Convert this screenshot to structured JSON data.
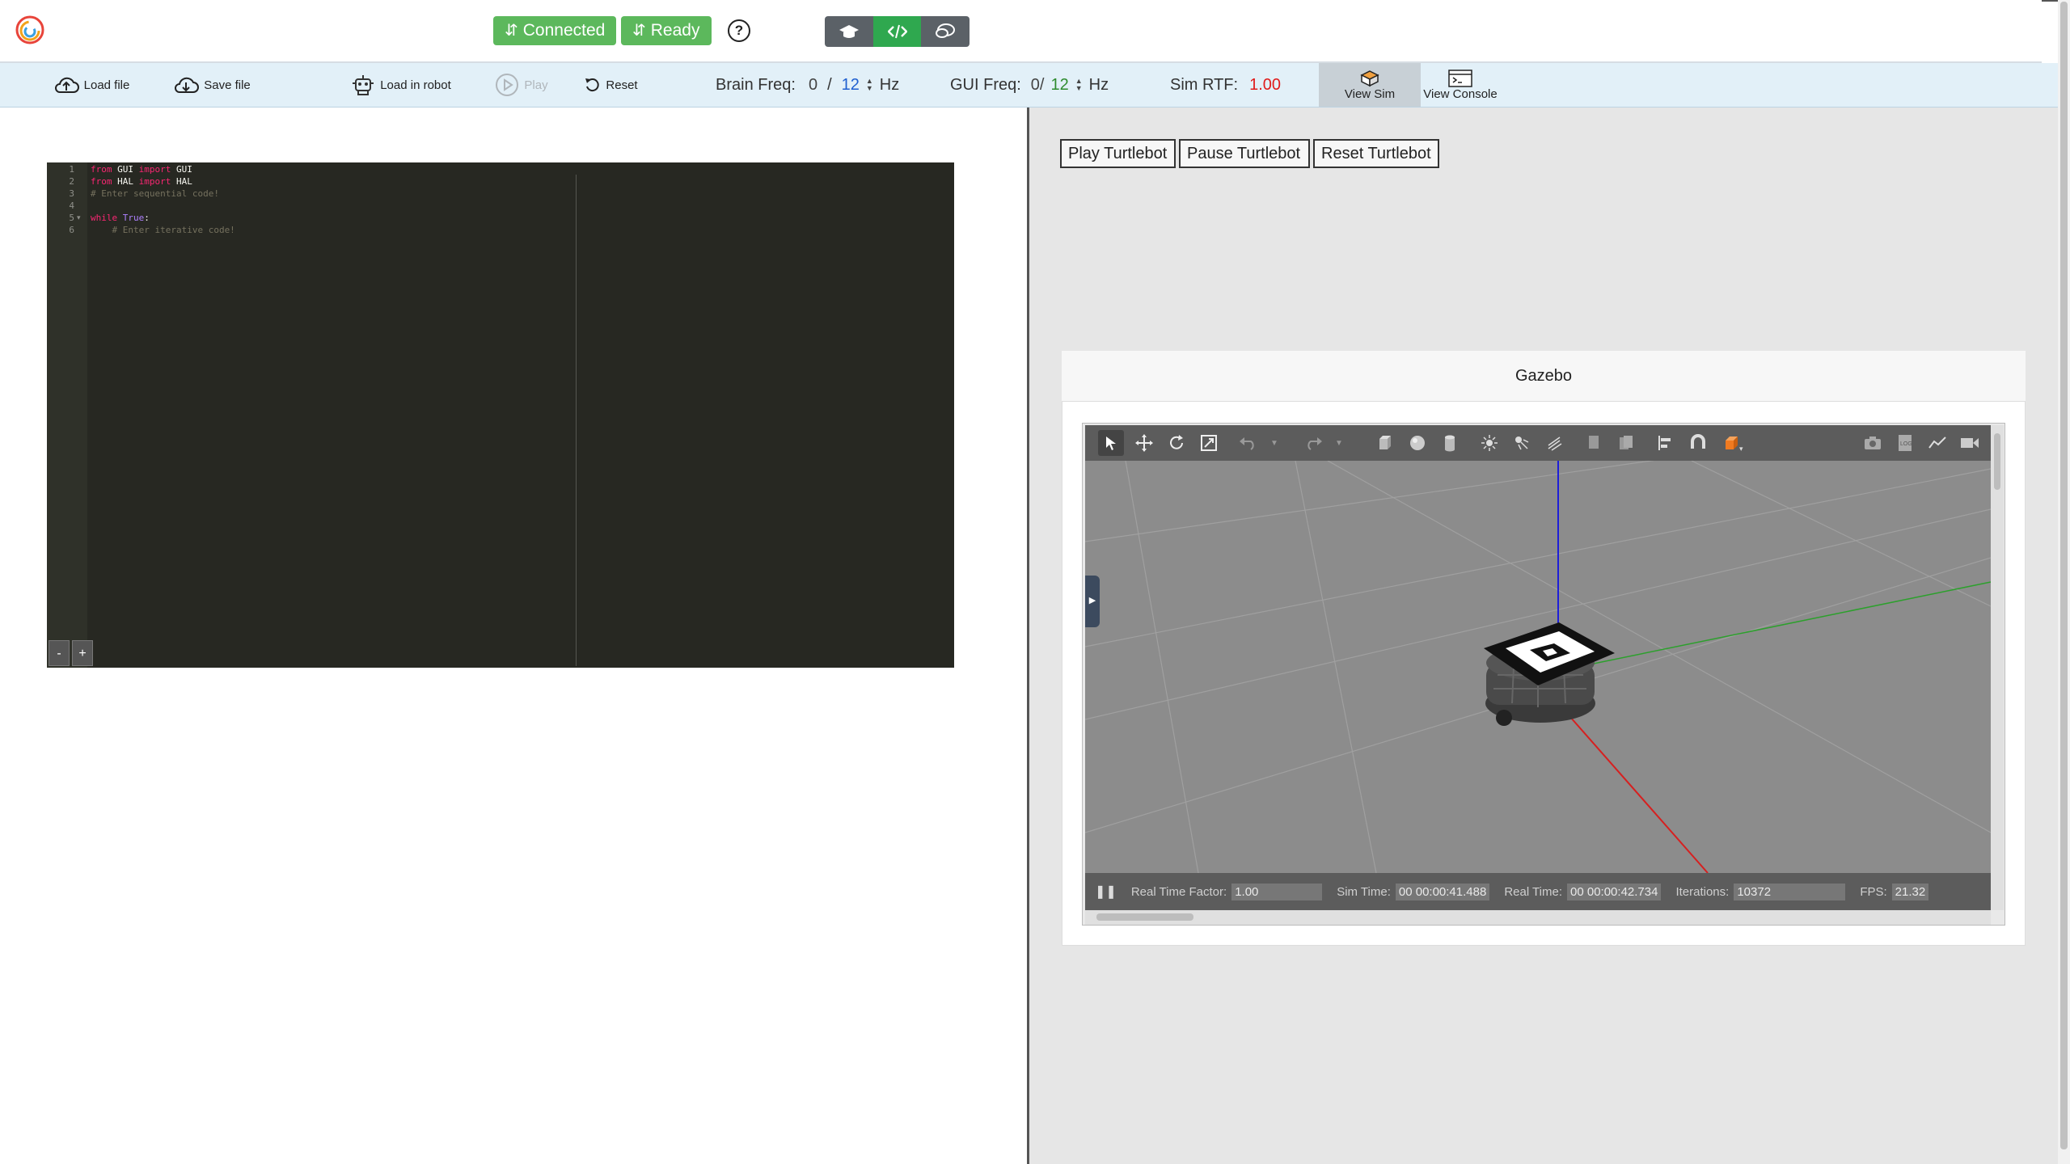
{
  "header": {
    "connected_label": "Connected",
    "ready_label": "Ready",
    "help_label": "?"
  },
  "toolbar": {
    "load_file": "Load file",
    "save_file": "Save file",
    "load_in_robot": "Load in robot",
    "play": "Play",
    "reset": "Reset",
    "brain_freq_label": "Brain Freq:",
    "brain_freq_current": "0",
    "brain_freq_sep": "/",
    "brain_freq_target": "12",
    "brain_freq_unit": "Hz",
    "gui_freq_label": "GUI Freq:",
    "gui_freq_current": "0/",
    "gui_freq_target": "12",
    "gui_freq_unit": "Hz",
    "sim_rtf_label": "Sim RTF:",
    "sim_rtf_value": "1.00",
    "view_sim": "View Sim",
    "view_console": "View Console"
  },
  "editor": {
    "line_numbers": [
      "1",
      "2",
      "3",
      "4",
      "5",
      "6"
    ],
    "lines": {
      "l1_kw": "from",
      "l1_a": " GUI ",
      "l1_kw2": "import",
      "l1_b": " GUI",
      "l2_kw": "from",
      "l2_a": " HAL ",
      "l2_kw2": "import",
      "l2_b": " HAL",
      "l3_cm": "# Enter sequential code!",
      "l5_kw": "while",
      "l5_bl": "True",
      "l5_c": ":",
      "l6_cm": "    # Enter iterative code!"
    },
    "zoom_out": "-",
    "zoom_in": "+"
  },
  "turtlebot": {
    "play": "Play Turtlebot",
    "pause": "Pause Turtlebot",
    "reset": "Reset Turtlebot"
  },
  "gazebo": {
    "title": "Gazebo",
    "real_time_factor_label": "Real Time Factor:",
    "real_time_factor": "1.00",
    "sim_time_label": "Sim Time:",
    "sim_time": "00 00:00:41.488",
    "real_time_label": "Real Time:",
    "real_time": "00 00:00:42.734",
    "iterations_label": "Iterations:",
    "iterations": "10372",
    "fps_label": "FPS:",
    "fps": "21.32"
  },
  "colors": {
    "ready_green": "#5cb85c",
    "toolbar_bg": "#e2f0f8",
    "editor_bg": "#272822",
    "rtf_red": "#e01b1b"
  }
}
